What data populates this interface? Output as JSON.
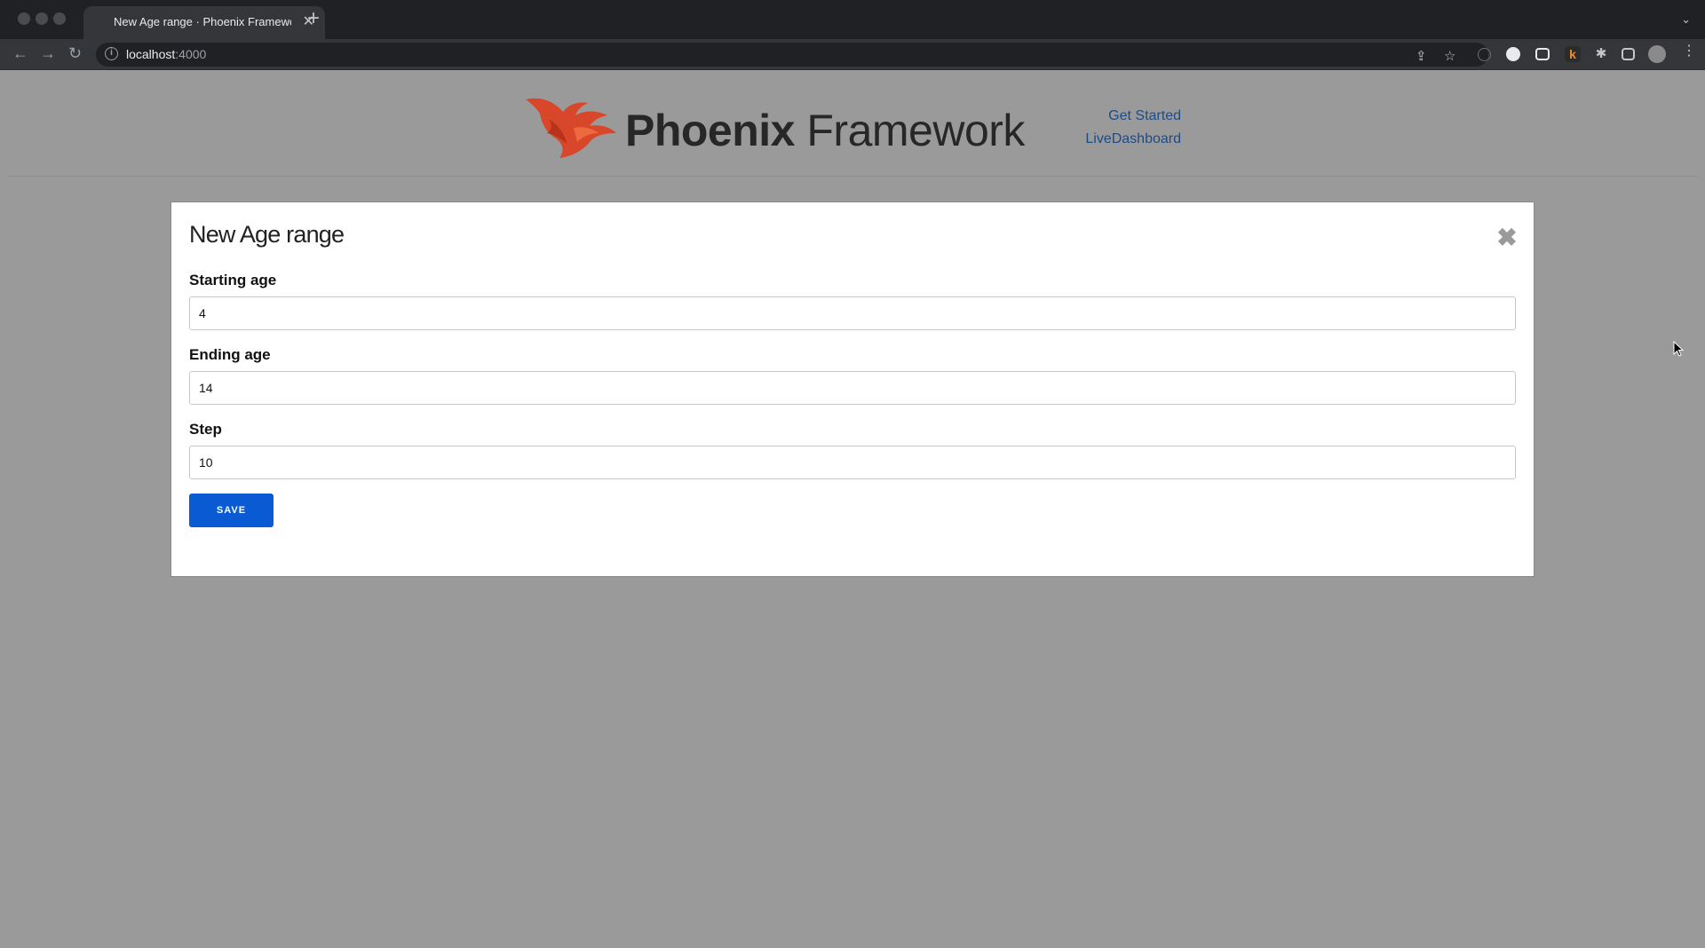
{
  "browser": {
    "tab_title": "New Age range · Phoenix Framework",
    "tab_close": "✕",
    "new_tab": "+",
    "url_host": "localhost",
    "url_port": ":4000"
  },
  "header": {
    "logo_text_bold": "Phoenix",
    "logo_text_light": " Framework",
    "nav": {
      "get_started": "Get Started",
      "live_dashboard": "LiveDashboard"
    }
  },
  "modal": {
    "title": "New Age range",
    "close_symbol": "✖",
    "fields": {
      "starting_age": {
        "label": "Starting age",
        "value": "4"
      },
      "ending_age": {
        "label": "Ending age",
        "value": "14"
      },
      "step": {
        "label": "Step",
        "value": "10"
      }
    },
    "save_label": "SAVE"
  },
  "colors": {
    "accent": "#0a5ad3",
    "link": "#1d4b86",
    "logo_orange": "#e04e2a",
    "overlay": "#9a9a9a"
  }
}
